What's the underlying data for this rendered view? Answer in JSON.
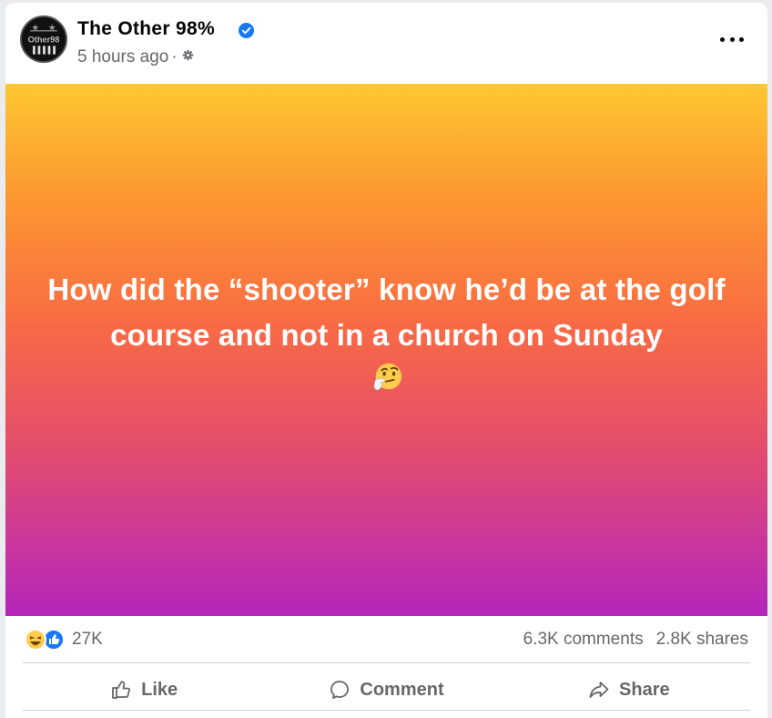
{
  "post": {
    "page_name": "The Other 98%",
    "avatar_text": "Other98",
    "timestamp": "5 hours ago",
    "separator": "·",
    "audience_icon": "gear-icon",
    "verified_icon": "verified-badge-icon",
    "body_text": "How did the “shooter” know he’d be at the golf course and not in a church on Sunday",
    "body_emoji": "thinking-face-emoji",
    "background_gradient": [
      "#fdc832",
      "#fc9a2f",
      "#f96b44",
      "#e44d6b",
      "#c835a0",
      "#b325b8"
    ]
  },
  "reactions": {
    "icons": [
      "haha-icon",
      "like-icon"
    ],
    "count": "27K",
    "comments": "6.3K comments",
    "shares": "2.8K shares"
  },
  "actions": {
    "like_label": "Like",
    "comment_label": "Comment",
    "share_label": "Share"
  },
  "colors": {
    "verified_blue": "#1877f2",
    "text_secondary": "#65676b",
    "text_primary": "#050505"
  }
}
